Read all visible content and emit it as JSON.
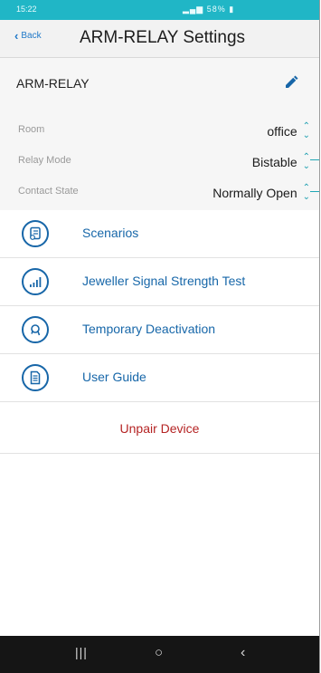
{
  "status_bar": {
    "time": "15:22",
    "signal": "58%"
  },
  "nav": {
    "back_label": "Back",
    "title": "ARM-RELAY Settings"
  },
  "device": {
    "name": "ARM-RELAY"
  },
  "settings": [
    {
      "label": "Room",
      "value": "office"
    },
    {
      "label": "Relay Mode",
      "value": "Bistable"
    },
    {
      "label": "Contact State",
      "value": "Normally Open"
    }
  ],
  "menu": [
    {
      "label": "Scenarios",
      "icon": "scenarios-icon"
    },
    {
      "label": "Jeweller Signal Strength Test",
      "icon": "signal-strength-icon"
    },
    {
      "label": "Temporary Deactivation",
      "icon": "deactivation-icon"
    },
    {
      "label": "User Guide",
      "icon": "document-icon"
    }
  ],
  "unpair_label": "Unpair Device",
  "colors": {
    "accent": "#1766a8",
    "status_bar": "#20b6c6",
    "danger": "#b52424",
    "callout": "#1fa7b5"
  }
}
